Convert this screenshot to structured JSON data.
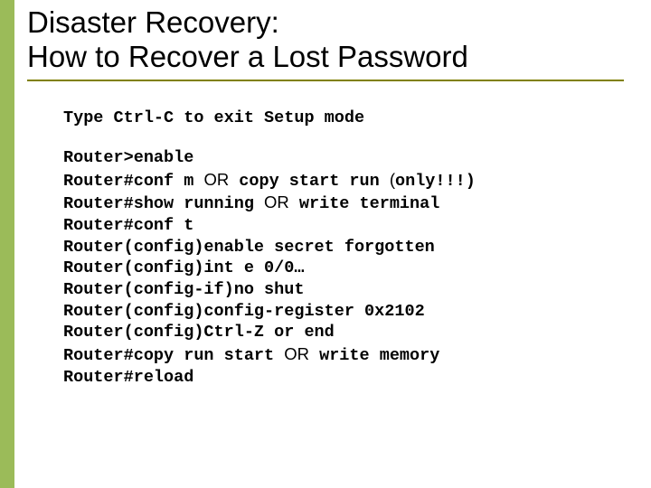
{
  "title": {
    "line1": "Disaster Recovery:",
    "line2": "How to Recover a Lost Password"
  },
  "instruction": "Type Ctrl-C to exit Setup mode",
  "commands": [
    {
      "pre": "Router>enable"
    },
    {
      "pre": "Router#conf m ",
      "mid": "OR",
      "post1": " copy start run ",
      "paren": "(",
      "post2": "only!!!)"
    },
    {
      "pre": "Router#show running ",
      "mid": "OR",
      "post1": " write terminal"
    },
    {
      "pre": "Router#conf t"
    },
    {
      "pre": "Router(config)enable secret forgotten"
    },
    {
      "pre": "Router(config)int e 0/0…"
    },
    {
      "pre": "Router(config-if)no shut"
    },
    {
      "pre": "Router(config)config-register 0x2102"
    },
    {
      "pre": "Router(config)Ctrl-Z or end"
    },
    {
      "pre": "Router#copy run start ",
      "mid": "OR",
      "post1": " write memory"
    },
    {
      "pre": "Router#reload"
    }
  ]
}
